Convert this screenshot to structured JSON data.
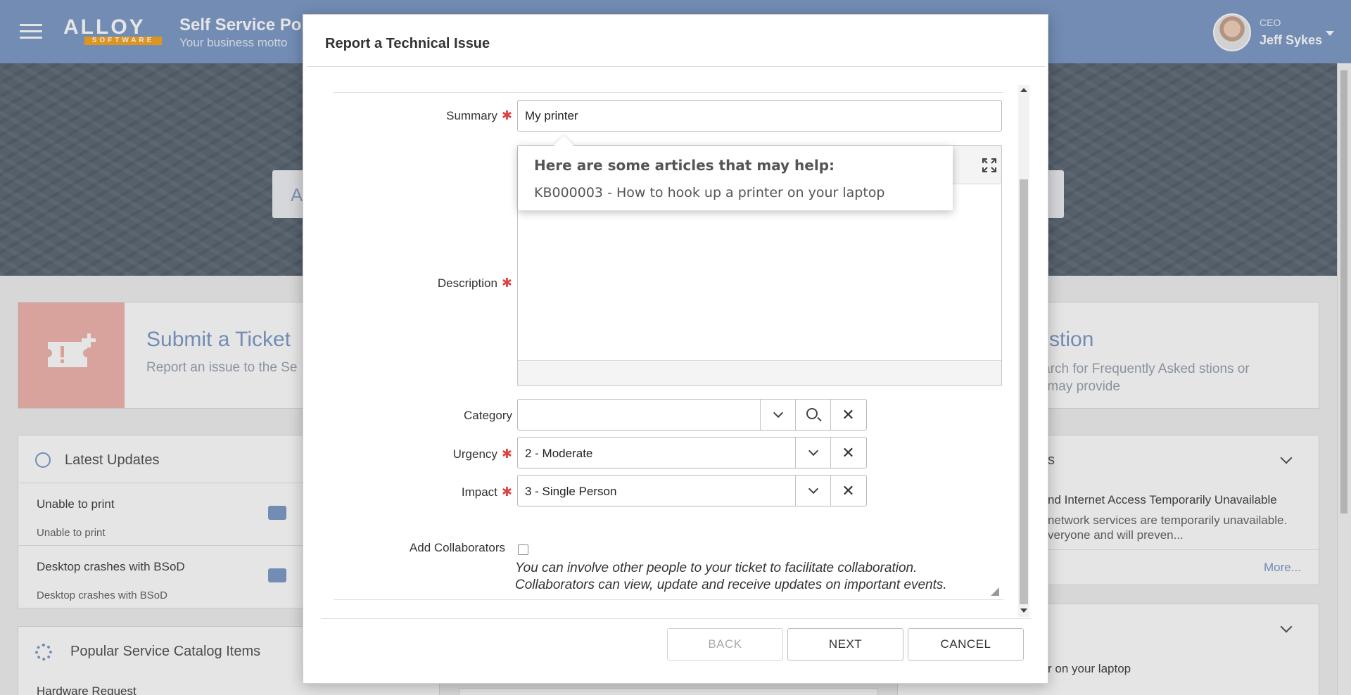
{
  "header": {
    "logo_top": "ALLOY",
    "logo_bottom": "SOFTWARE",
    "portal_title": "Self Service Por",
    "portal_motto": "Your business motto",
    "user_role": "CEO",
    "user_name": "Jeff Sykes"
  },
  "hero": {
    "search_fragment": "A"
  },
  "cards": {
    "ticket": {
      "title": "Submit a Ticket",
      "desc": "Report an issue to the Se"
    },
    "question": {
      "title": "k a Question",
      "desc": "wse and search for Frequently Asked stions or articles that may provide"
    },
    "updates": {
      "title": "Latest Updates",
      "items": [
        {
          "title": "Unable to print",
          "sub": "Unable to print"
        },
        {
          "title": "Desktop crashes with BSoD",
          "sub": "Desktop crashes with BSoD"
        }
      ]
    },
    "catalog": {
      "title": "Popular Service Catalog Items",
      "first_item": "Hardware Request"
    },
    "alert": {
      "heading_fragment": "s",
      "title": "nd Internet Access Temporarily Unavailable",
      "text": "network services are temporarily unavailable. veryone and will preven...",
      "more": "More..."
    },
    "kb": {
      "line": "r on your laptop"
    }
  },
  "modal": {
    "title": "Report a Technical Issue",
    "fields": {
      "summary": {
        "label": "Summary",
        "value": "My printer"
      },
      "description": {
        "label": "Description"
      },
      "category": {
        "label": "Category",
        "value": ""
      },
      "urgency": {
        "label": "Urgency",
        "value": "2 - Moderate"
      },
      "impact": {
        "label": "Impact",
        "value": "3 - Single Person"
      },
      "collaborators": {
        "label": "Add Collaborators",
        "checked": false,
        "help_line1": "You can involve other people to your ticket to facilitate collaboration.",
        "help_line2": "Collaborators can view, update and receive updates on important events."
      }
    },
    "suggestions": {
      "heading": "Here are some articles that may help:",
      "articles": [
        "KB000003 - How to hook up a printer on your laptop"
      ]
    },
    "buttons": {
      "back": "BACK",
      "next": "NEXT",
      "cancel": "CANCEL"
    }
  },
  "colors": {
    "header_bg": "#7f9cc9",
    "accent": "#7f9cc9",
    "required": "#e04040",
    "ticket_tile": "#f0b6ae"
  }
}
